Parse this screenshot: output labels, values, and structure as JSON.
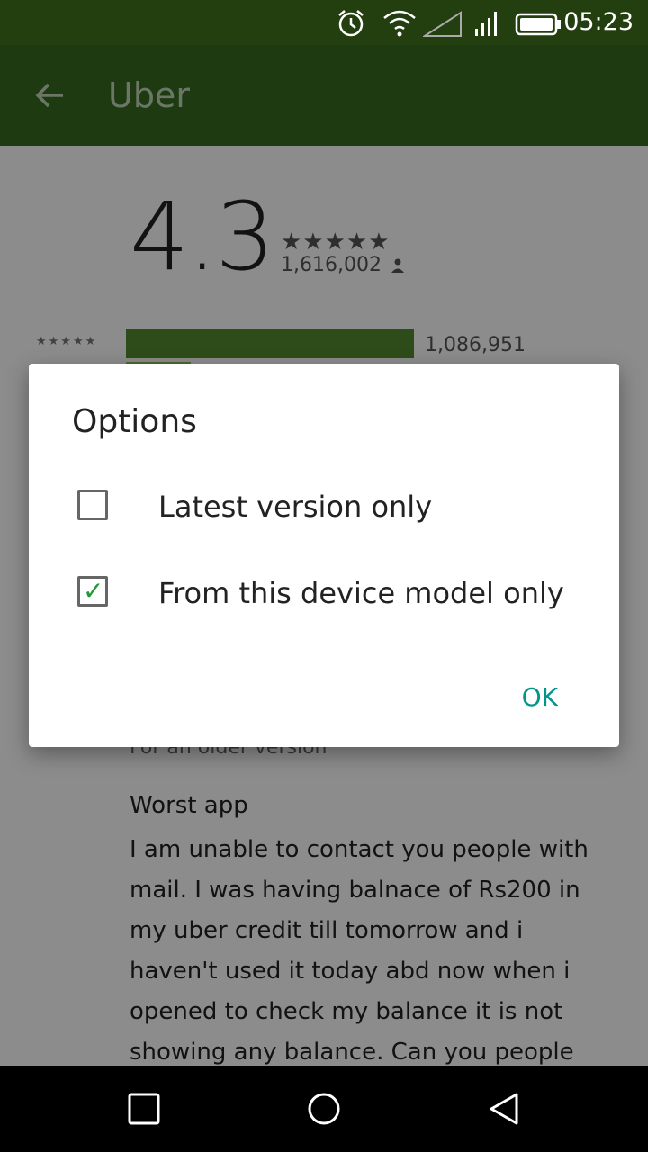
{
  "status_bar": {
    "time": "05:23"
  },
  "app_bar": {
    "title": "Uber"
  },
  "rating": {
    "value": "4.3",
    "stars": "★★★★★",
    "total": "1,616,002",
    "five_star_stars": "★★★★★",
    "five_star_count": "1,086,951"
  },
  "reviews": {
    "older_note": "For an older version",
    "title": "Worst app",
    "body": "I am unable to contact you people with mail. I was having balnace of Rs200 in my uber credit till tomorrow and i haven't used it today abd now when i opened to check my balance it is not showing any balance. Can you people solve my concern as i am"
  },
  "dialog": {
    "title": "Options",
    "options": [
      {
        "label": "Latest version only",
        "checked": false
      },
      {
        "label": "From this device model only",
        "checked": true
      }
    ],
    "ok_label": "OK"
  },
  "colors": {
    "accent": "#009688",
    "appbar": "#366b1f",
    "statusbar": "#243f0f",
    "bar": "#558b2f"
  }
}
